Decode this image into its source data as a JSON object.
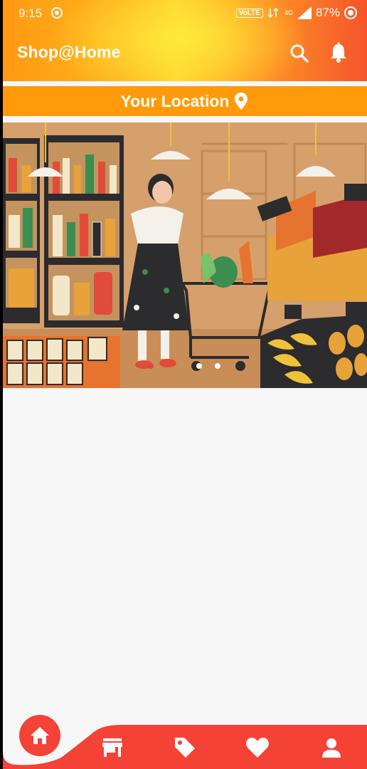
{
  "status_bar": {
    "time": "9:15",
    "network_badge": "VoLTE",
    "network_type": "4G",
    "battery": "87%"
  },
  "app_bar": {
    "title": "Shop@Home",
    "search_icon": "search-icon",
    "notifications_icon": "bell-icon"
  },
  "location": {
    "label": "Your Location",
    "icon": "location-pin-icon"
  },
  "banner": {
    "description": "grocery store illustration",
    "slide_count": 3,
    "active_slide": 0
  },
  "bottom_nav": {
    "items": [
      "home-icon",
      "store-icon",
      "tag-icon",
      "heart-icon",
      "person-icon"
    ],
    "active": "home-icon"
  },
  "colors": {
    "accent_red": "#f44236",
    "location_orange": "#ff9a0a",
    "header_gradient": [
      "#ff9a12",
      "#ffd22c",
      "#f5542c"
    ]
  }
}
